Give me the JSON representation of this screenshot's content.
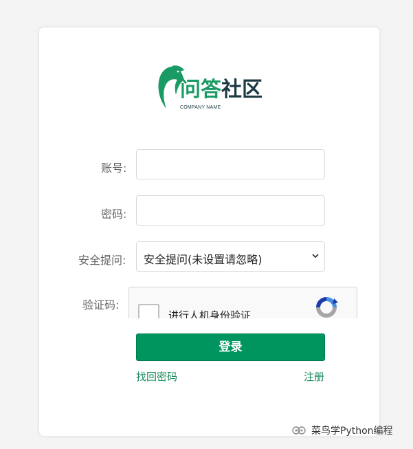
{
  "logo": {
    "title_part1": "问答",
    "title_part2": "社区",
    "subtitle": "COMPANY NAME",
    "colors": {
      "green": "#1a9b63",
      "dark": "#1c3a42"
    }
  },
  "form": {
    "account_label": "账号:",
    "account_value": "",
    "password_label": "密码:",
    "password_value": "",
    "security_label": "安全提问:",
    "security_selected": "安全提问(未设置请忽略)",
    "captcha_label": "验证码:",
    "captcha_text": "进行人机身份验证",
    "login_label": "登录",
    "forgot_label": "找回密码",
    "register_label": "注册"
  },
  "watermark": {
    "text": "菜鸟学Python编程",
    "icon": "wechat-official-account-icon"
  },
  "colors": {
    "accent": "#00945e",
    "link": "#1a8a5c",
    "background": "#f4f4f4"
  }
}
